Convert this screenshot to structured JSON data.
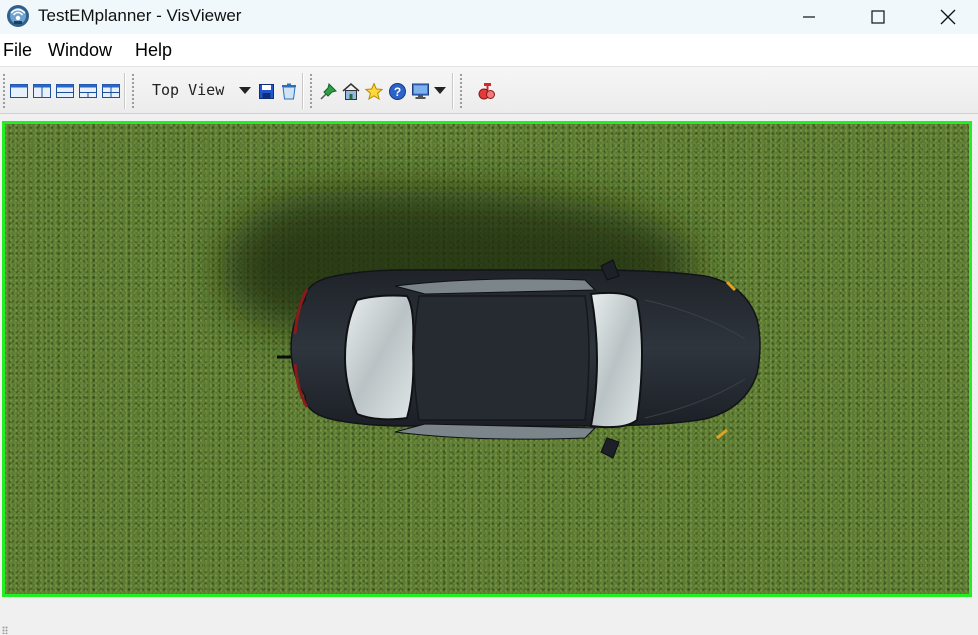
{
  "window": {
    "title": "TestEMplanner - VisViewer"
  },
  "menu": {
    "items": [
      {
        "label": "File"
      },
      {
        "label": "Window"
      },
      {
        "label": "Help"
      }
    ]
  },
  "toolbar": {
    "view_mode": "Top View",
    "layout_icons": [
      "single-view-icon",
      "two-column-view-icon",
      "two-row-view-icon",
      "three-view-icon",
      "quad-view-icon"
    ],
    "action_icons": [
      "save-icon",
      "clear-icon",
      "pin-icon",
      "home-icon",
      "star-icon",
      "help-icon",
      "monitor-icon",
      "record-icon"
    ]
  },
  "viewport": {
    "border_color": "#22ee22",
    "ground_color": "#5c7a33",
    "car_color": "#2b2f36"
  }
}
